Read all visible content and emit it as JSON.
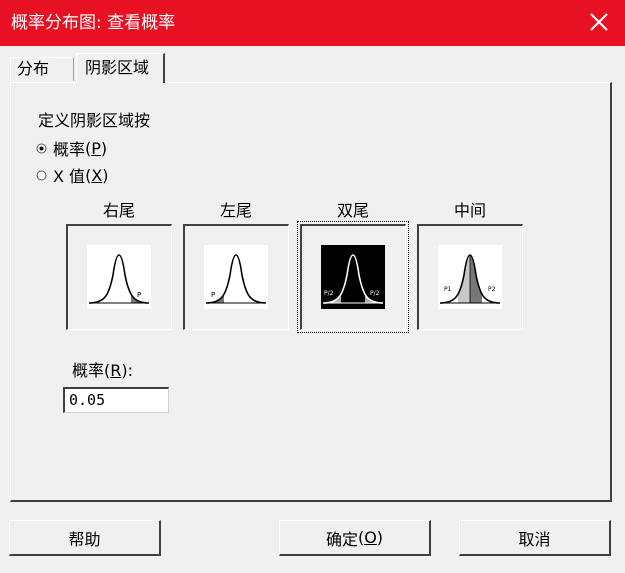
{
  "window": {
    "title": "概率分布图: 查看概率",
    "close_icon": "close-icon"
  },
  "tabs": [
    {
      "label": "分布",
      "active": false
    },
    {
      "label": "阴影区域",
      "active": true
    }
  ],
  "shade_section": {
    "heading": "定义阴影区域按",
    "radio_probability": {
      "label": "概率",
      "key": "P",
      "selected": true
    },
    "radio_xvalue": {
      "label": "X 值",
      "key": "X",
      "selected": false
    }
  },
  "options": [
    {
      "label": "右尾",
      "img_label": "P"
    },
    {
      "label": "左尾",
      "img_label": "P"
    },
    {
      "label": "双尾",
      "img_label_left": "P/2",
      "img_label_right": "P/2",
      "selected": true
    },
    {
      "label": "中间",
      "img_label_left": "P1",
      "img_label_right": "P2"
    }
  ],
  "probability": {
    "label": "概率",
    "key": "R",
    "suffix": ":",
    "value": "0.05"
  },
  "buttons": {
    "help": "帮助",
    "ok_label": "确定",
    "ok_key": "O",
    "cancel": "取消"
  },
  "colors": {
    "titlebar": "#e81123",
    "dialog_bg": "#f0f0f0"
  }
}
